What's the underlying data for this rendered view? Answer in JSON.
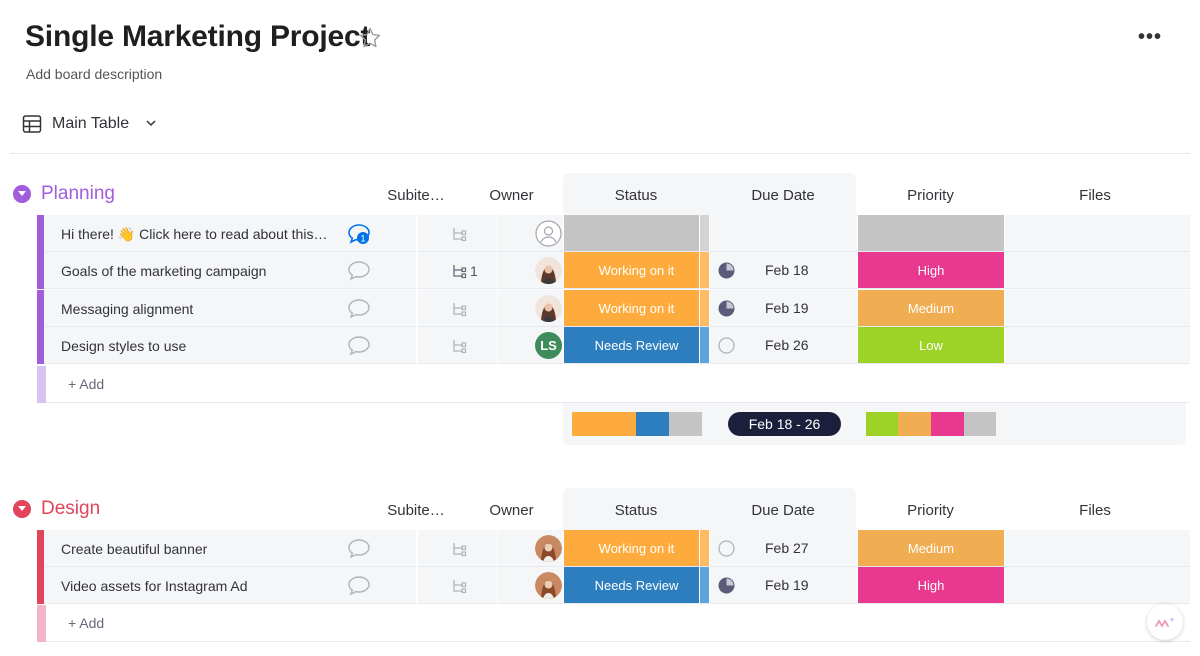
{
  "board": {
    "title": "Single Marketing Project",
    "description": "Add board description",
    "more": "•••"
  },
  "view": {
    "label": "Main Table"
  },
  "columns": {
    "subitems": "Subite…",
    "owner": "Owner",
    "status": "Status",
    "due_date": "Due Date",
    "priority": "Priority",
    "files": "Files"
  },
  "colors": {
    "planning": "#a25ddc",
    "design": "#e2445c",
    "working": "#fdab3d",
    "review": "#2d7ebf",
    "empty": "#c4c4c4",
    "high": "#e8388f",
    "medium": "#f0ad52",
    "low": "#9cd326"
  },
  "groups": [
    {
      "name": "Planning",
      "add_label": "+ Add",
      "rows": [
        {
          "name": "Hi there! 👋 Click here to read about this te…",
          "updates": "1",
          "subitems": "",
          "status": "",
          "due": "",
          "priority": ""
        },
        {
          "name": "Goals of the marketing campaign",
          "subitems": "1",
          "status": "Working on it",
          "due": "Feb 18",
          "priority": "High"
        },
        {
          "name": "Messaging alignment",
          "subitems": "",
          "status": "Working on it",
          "due": "Feb 19",
          "priority": "Medium"
        },
        {
          "name": "Design styles to use",
          "subitems": "",
          "owner_initials": "LS",
          "status": "Needs Review",
          "due": "Feb 26",
          "priority": "Low"
        }
      ],
      "summary": {
        "date_range": "Feb 18 - 26"
      }
    },
    {
      "name": "Design",
      "add_label": "+ Add",
      "rows": [
        {
          "name": "Create beautiful banner",
          "status": "Working on it",
          "due": "Feb 27",
          "priority": "Medium"
        },
        {
          "name": "Video assets for Instagram Ad",
          "status": "Needs Review",
          "due": "Feb 19",
          "priority": "High"
        }
      ]
    }
  ]
}
